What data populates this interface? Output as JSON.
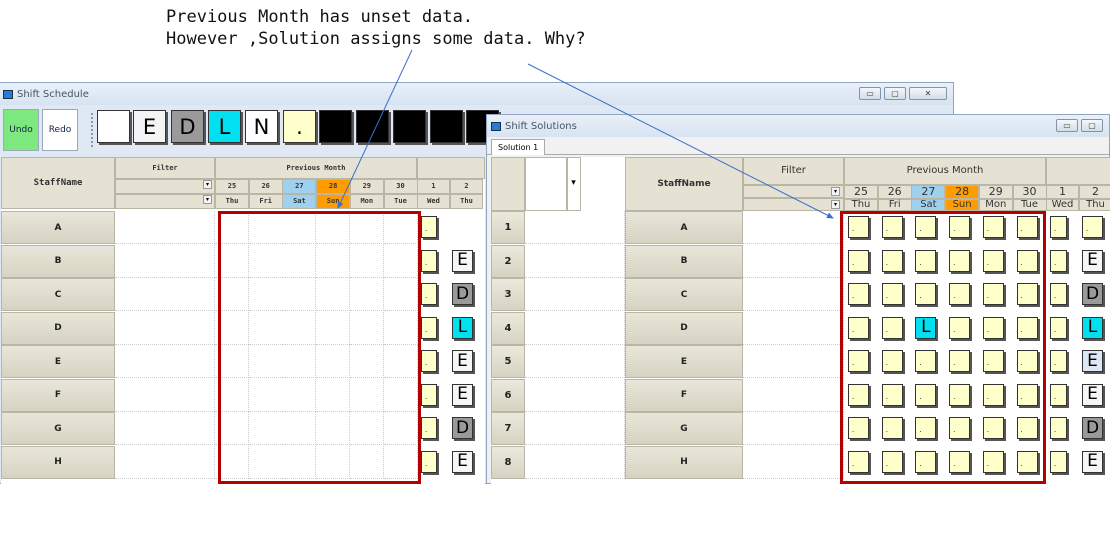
{
  "annotation": {
    "line1": "Previous Month has unset data.",
    "line2": "However ,Solution assigns some data. Why?"
  },
  "window1": {
    "title": "Shift Schedule",
    "undo_label": "Undo",
    "redo_label": "Redo",
    "swatches": [
      {
        "label": "",
        "color": "#ffffff",
        "text_color": "#000000"
      },
      {
        "label": "E",
        "color": "#f4f4f4",
        "text_color": "#000000"
      },
      {
        "label": "D",
        "color": "#9a9a9a",
        "text_color": "#000000"
      },
      {
        "label": "L",
        "color": "#00e0f0",
        "text_color": "#000000"
      },
      {
        "label": "N",
        "color": "#ffffff",
        "text_color": "#000000"
      },
      {
        "label": ".",
        "color": "#ffffcc",
        "text_color": "#000000"
      },
      {
        "label": "",
        "color": "#000000",
        "text_color": "#ffffff"
      },
      {
        "label": "",
        "color": "#000000",
        "text_color": "#ffffff"
      },
      {
        "label": "",
        "color": "#000000",
        "text_color": "#ffffff"
      },
      {
        "label": "",
        "color": "#000000",
        "text_color": "#ffffff"
      },
      {
        "label": "",
        "color": "#000000",
        "text_color": "#ffffff"
      }
    ],
    "staff_header": "StaffName",
    "filter_header": "Filter",
    "prev_month_header": "Previous Month",
    "days": [
      {
        "num": "25",
        "dow": "Thu"
      },
      {
        "num": "26",
        "dow": "Fri"
      },
      {
        "num": "27",
        "dow": "Sat"
      },
      {
        "num": "28",
        "dow": "Sun"
      },
      {
        "num": "29",
        "dow": "Mon"
      },
      {
        "num": "30",
        "dow": "Tue"
      }
    ],
    "next_days": [
      {
        "num": "1",
        "dow": "Wed"
      },
      {
        "num": "2",
        "dow": "Thu"
      }
    ],
    "rows": [
      {
        "name": "A",
        "day1": ".",
        "day2": ""
      },
      {
        "name": "B",
        "day1": ".",
        "day2": "E"
      },
      {
        "name": "C",
        "day1": ".",
        "day2": "D"
      },
      {
        "name": "D",
        "day1": ".",
        "day2": "L"
      },
      {
        "name": "E",
        "day1": ".",
        "day2": "E"
      },
      {
        "name": "F",
        "day1": ".",
        "day2": "E"
      },
      {
        "name": "G",
        "day1": ".",
        "day2": "D"
      },
      {
        "name": "H",
        "day1": ".",
        "day2": "E"
      }
    ]
  },
  "window2": {
    "title": "Shift Solutions",
    "tab_label": "Solution 1",
    "staff_header": "StaffName",
    "filter_header": "Filter",
    "prev_month_header": "Previous Month",
    "days": [
      {
        "num": "25",
        "dow": "Thu"
      },
      {
        "num": "26",
        "dow": "Fri"
      },
      {
        "num": "27",
        "dow": "Sat"
      },
      {
        "num": "28",
        "dow": "Sun"
      },
      {
        "num": "29",
        "dow": "Mon"
      },
      {
        "num": "30",
        "dow": "Tue"
      }
    ],
    "next_days": [
      {
        "num": "1",
        "dow": "Wed"
      },
      {
        "num": "2",
        "dow": "Thu"
      }
    ],
    "rows": [
      {
        "num": "1",
        "name": "A",
        "prev": [
          ".",
          ".",
          ".",
          ".",
          ".",
          "."
        ],
        "d1": ".",
        "d2": "."
      },
      {
        "num": "2",
        "name": "B",
        "prev": [
          ".",
          ".",
          ".",
          ".",
          ".",
          "."
        ],
        "d1": ".",
        "d2": "E"
      },
      {
        "num": "3",
        "name": "C",
        "prev": [
          ".",
          ".",
          ".",
          ".",
          ".",
          "."
        ],
        "d1": ".",
        "d2": "D"
      },
      {
        "num": "4",
        "name": "D",
        "prev": [
          ".",
          ".",
          "L",
          ".",
          ".",
          "."
        ],
        "d1": ".",
        "d2": "L"
      },
      {
        "num": "5",
        "name": "E",
        "prev": [
          ".",
          ".",
          ".",
          ".",
          ".",
          "."
        ],
        "d1": ".",
        "d2": "E"
      },
      {
        "num": "6",
        "name": "F",
        "prev": [
          ".",
          ".",
          ".",
          ".",
          ".",
          "."
        ],
        "d1": ".",
        "d2": "E"
      },
      {
        "num": "7",
        "name": "G",
        "prev": [
          ".",
          ".",
          ".",
          ".",
          ".",
          "."
        ],
        "d1": ".",
        "d2": "D"
      },
      {
        "num": "8",
        "name": "H",
        "prev": [
          ".",
          ".",
          ".",
          ".",
          ".",
          "."
        ],
        "d1": ".",
        "d2": "E"
      }
    ]
  },
  "colors": {
    "undo_bg": "#7de87d",
    "redo_bg": "#ffffff",
    "highlight_day": "#ff9c00",
    "sat_day": "#9fd0ee",
    "redbox": "#b30000",
    "arrow": "#3a6fc9"
  }
}
